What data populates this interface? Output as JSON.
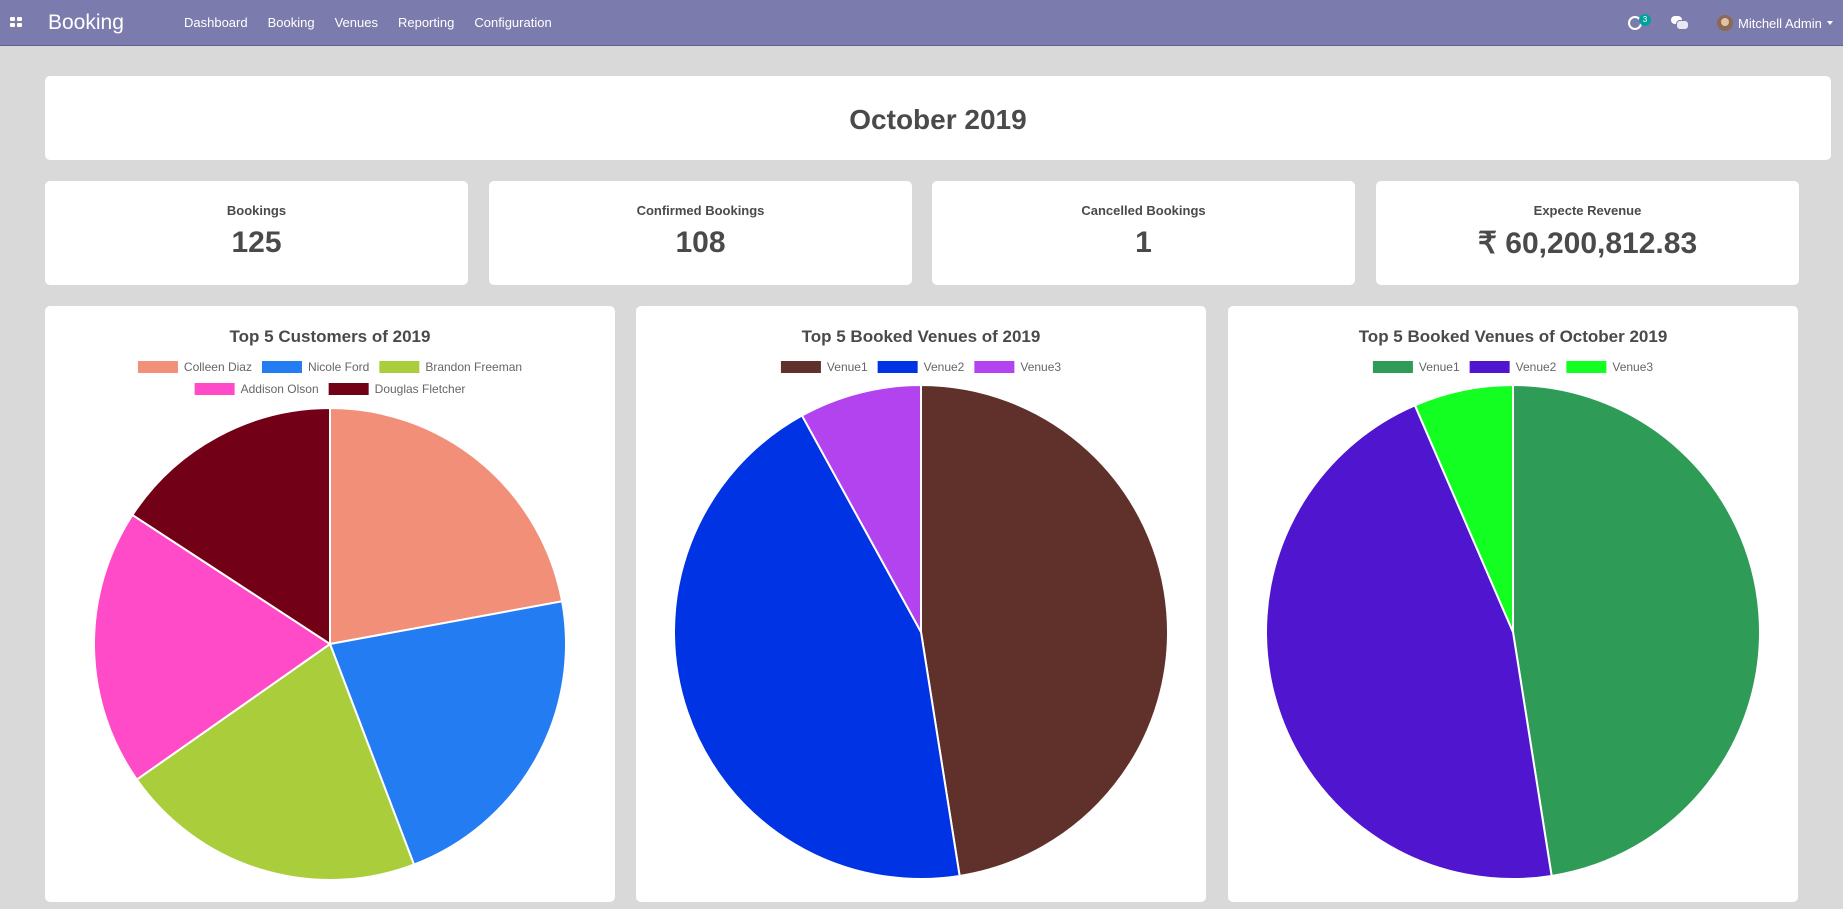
{
  "navbar": {
    "brand": "Booking",
    "menu": [
      "Dashboard",
      "Booking",
      "Venues",
      "Reporting",
      "Configuration"
    ],
    "activity_count": "3",
    "user_name": "Mitchell Admin",
    "bg_color": "#7c7bad"
  },
  "page": {
    "title": "October 2019"
  },
  "stats": [
    {
      "label": "Bookings",
      "value": "125"
    },
    {
      "label": "Confirmed Bookings",
      "value": "108"
    },
    {
      "label": "Cancelled Bookings",
      "value": "1"
    },
    {
      "label": "Expecte Revenue",
      "value": "₹ 60,200,812.83"
    }
  ],
  "chart_data": [
    {
      "type": "pie",
      "title": "Top 5 Customers of 2019",
      "categories": [
        "Colleen Diaz",
        "Nicole Ford",
        "Brandon Freeman",
        "Addison Olson",
        "Douglas Fletcher"
      ],
      "values": [
        21,
        21,
        20,
        18,
        15
      ],
      "colors": [
        "#f28f79",
        "#247cf2",
        "#a9cd3b",
        "#ff4bc8",
        "#720016"
      ],
      "legend": "top"
    },
    {
      "type": "pie",
      "title": "Top 5 Booked Venues of 2019",
      "categories": [
        "Venue1",
        "Venue2",
        "Venue3"
      ],
      "values": [
        47.5,
        44.5,
        8
      ],
      "colors": [
        "#60302b",
        "#0033e3",
        "#b243ef"
      ],
      "legend": "top"
    },
    {
      "type": "pie",
      "title": "Top 5 Booked Venues of October 2019",
      "categories": [
        "Venue1",
        "Venue2",
        "Venue3"
      ],
      "values": [
        47.5,
        46,
        6.5
      ],
      "colors": [
        "#2e9b56",
        "#4f15cf",
        "#12ff21"
      ],
      "legend": "top"
    }
  ]
}
